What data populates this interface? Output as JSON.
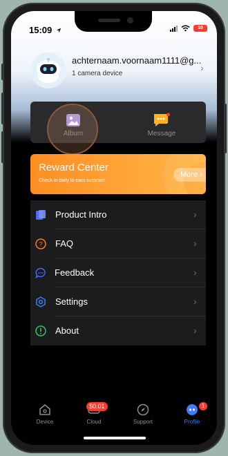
{
  "status_bar": {
    "time": "15:09",
    "battery": "10"
  },
  "profile": {
    "username": "achternaam.voornaam1111@g...",
    "device_count": "1 camera device"
  },
  "quick_actions": [
    {
      "label": "Album",
      "icon": "album-icon"
    },
    {
      "label": "Message",
      "icon": "message-icon",
      "has_dot": true
    }
  ],
  "reward": {
    "title": "Reward Center",
    "subtitle": "Check in daily to earn surprise!",
    "more_label": "More"
  },
  "menu": [
    {
      "label": "Product Intro",
      "icon": "product-intro-icon",
      "color": "#4a6cf7"
    },
    {
      "label": "FAQ",
      "icon": "faq-icon",
      "color": "#ff7a1a"
    },
    {
      "label": "Feedback",
      "icon": "feedback-icon",
      "color": "#4a6cf7"
    },
    {
      "label": "Settings",
      "icon": "settings-icon",
      "color": "#3d7bff"
    },
    {
      "label": "About",
      "icon": "about-icon",
      "color": "#34c759"
    }
  ],
  "tabs": [
    {
      "label": "Device",
      "icon": "device-icon"
    },
    {
      "label": "Cloud",
      "icon": "cloud-icon",
      "badge": "$0.01"
    },
    {
      "label": "Support",
      "icon": "support-icon"
    },
    {
      "label": "Profile",
      "icon": "profile-icon",
      "badge": "1",
      "active": true
    }
  ],
  "colors": {
    "accent": "#3d7bff",
    "reward_orange": "#ff9a2e",
    "badge_red": "#ff3b30",
    "message_yellow": "#ffb21e"
  }
}
